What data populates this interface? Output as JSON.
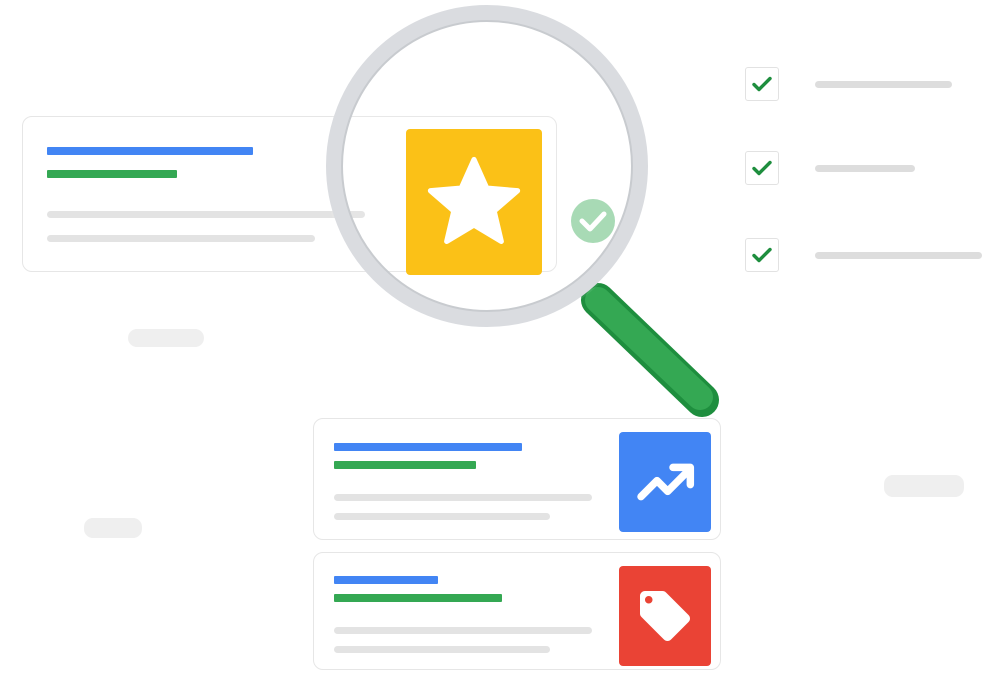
{
  "icons": {
    "star": "star-icon",
    "trend": "trending-up-icon",
    "tag": "price-tag-icon",
    "check": "checkmark-icon",
    "magnifier": "magnifying-glass-icon"
  },
  "colors": {
    "blue": "#4285F4",
    "green": "#34A853",
    "yellow": "#FBBC04",
    "red": "#EA4335",
    "gray_line": "#E3E3E3",
    "lens_ring": "#DADCE0",
    "badge": "#A8DAB5"
  },
  "checklist": {
    "items": [
      {
        "checked": true
      },
      {
        "checked": true
      },
      {
        "checked": true
      }
    ]
  }
}
